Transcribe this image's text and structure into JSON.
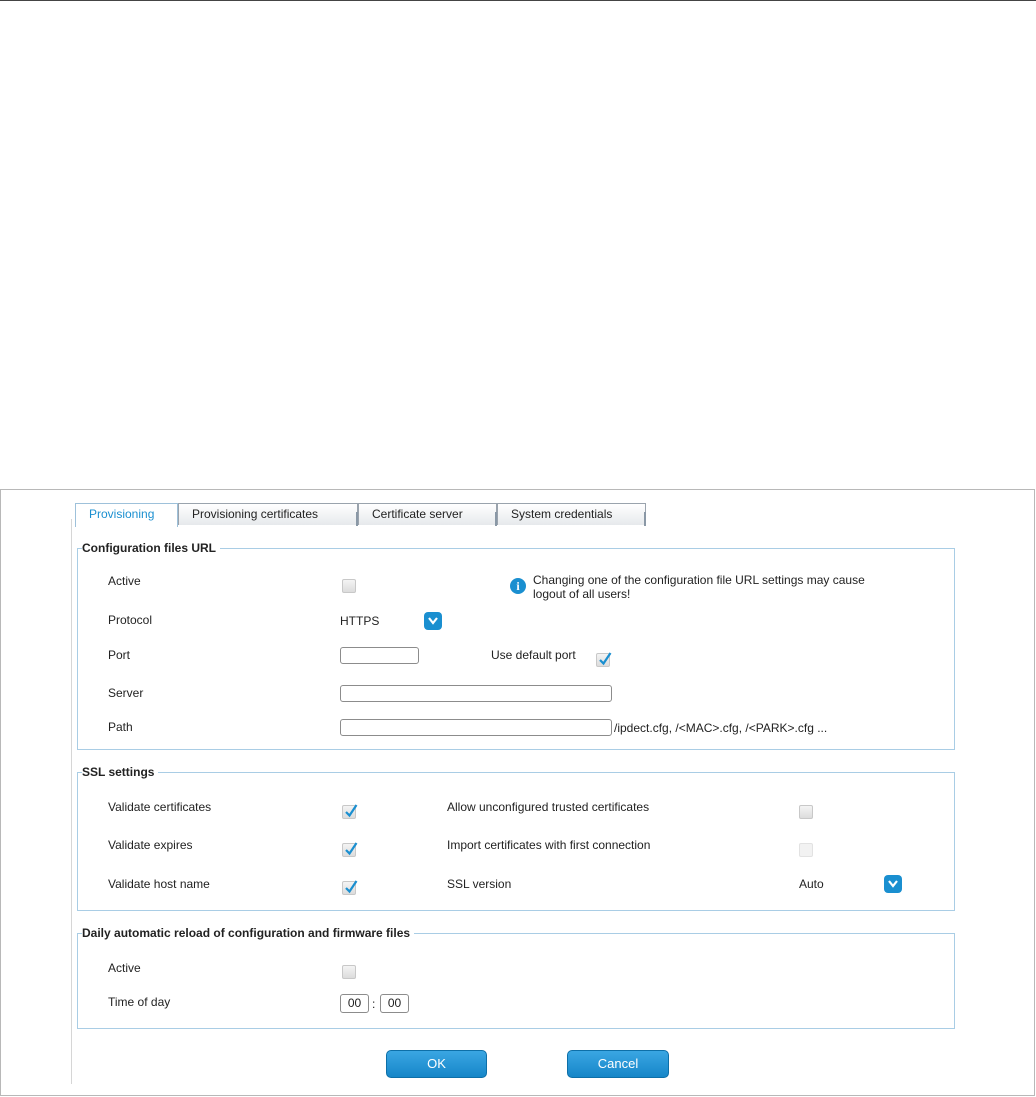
{
  "tabs": [
    {
      "label": "Provisioning",
      "active": true
    },
    {
      "label": "Provisioning certificates",
      "active": false
    },
    {
      "label": "Certificate server",
      "active": false
    },
    {
      "label": "System credentials",
      "active": false
    }
  ],
  "config": {
    "legend": "Configuration files URL",
    "active_label": "Active",
    "active_checked": false,
    "info_text": "Changing one of the configuration file URL settings may cause logout of all users!",
    "protocol_label": "Protocol",
    "protocol_value": "HTTPS",
    "port_label": "Port",
    "port_value": "",
    "use_default_port_label": "Use default port",
    "use_default_port_checked": true,
    "server_label": "Server",
    "server_value": "",
    "path_label": "Path",
    "path_value": "",
    "path_suffix": "/ipdect.cfg, /<MAC>.cfg, /<PARK>.cfg ..."
  },
  "ssl": {
    "legend": "SSL settings",
    "validate_certificates_label": "Validate certificates",
    "validate_certificates_checked": true,
    "validate_expires_label": "Validate expires",
    "validate_expires_checked": true,
    "validate_host_name_label": "Validate host name",
    "validate_host_name_checked": true,
    "allow_unconfigured_label": "Allow unconfigured trusted certificates",
    "allow_unconfigured_checked": false,
    "import_first_label": "Import certificates with first connection",
    "import_first_checked": false,
    "ssl_version_label": "SSL version",
    "ssl_version_value": "Auto"
  },
  "reload": {
    "legend": "Daily automatic reload of configuration and firmware files",
    "active_label": "Active",
    "active_checked": false,
    "time_label": "Time of day",
    "hour": "00",
    "separator": ":",
    "minute": "00"
  },
  "buttons": {
    "ok": "OK",
    "cancel": "Cancel"
  },
  "colors": {
    "accent": "#1a8fd0",
    "fieldset_border": "#a9cde5"
  }
}
